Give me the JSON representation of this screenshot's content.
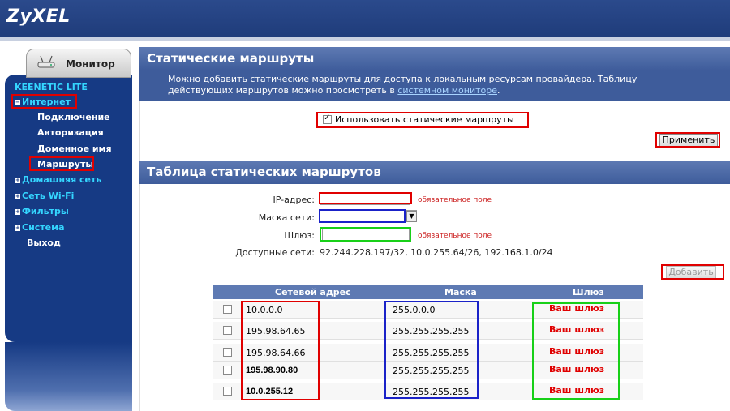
{
  "brand": {
    "logo": "ZyXEL"
  },
  "sidebar": {
    "monitor_tab": "Монитор",
    "model": "KEENETIC LITE",
    "items": [
      {
        "label": "Интернет"
      },
      {
        "label": "Подключение"
      },
      {
        "label": "Авторизация"
      },
      {
        "label": "Доменное имя"
      },
      {
        "label": "Маршруты"
      },
      {
        "label": "Домашняя сеть"
      },
      {
        "label": "Сеть Wi-Fi"
      },
      {
        "label": "Фильтры"
      },
      {
        "label": "Система"
      },
      {
        "label": "Выход"
      }
    ]
  },
  "static_routes": {
    "title": "Статические маршруты",
    "description_line1": "Можно добавить статические маршруты для доступа к локальным ресурсам провайдера. Таблицу",
    "description_line2_prefix": "действующих маршрутов можно просмотреть в",
    "description_link": "системном мониторе",
    "description_line2_suffix": ".",
    "use_static_label": "Использовать статические маршруты",
    "use_static_checked": true,
    "apply_button": "Применить"
  },
  "route_table": {
    "title": "Таблица статических маршрутов",
    "ip_label": "IP-адрес:",
    "mask_label": "Маска сети:",
    "gateway_label": "Шлюз:",
    "required_hint": "обязательное поле",
    "available_label": "Доступные сети:",
    "available_value": "92.244.228.197/32, 10.0.255.64/26, 192.168.1.0/24",
    "add_button": "Добавить",
    "columns": {
      "network": "Сетевой адрес",
      "mask": "Маска",
      "gateway": "Шлюз"
    },
    "rows": [
      {
        "network": "10.0.0.0",
        "mask": "255.0.0.0",
        "gateway": "Ваш шлюз"
      },
      {
        "network": "195.98.64.65",
        "mask": "255.255.255.255",
        "gateway": "Ваш шлюз"
      },
      {
        "network": "195.98.64.66",
        "mask": "255.255.255.255",
        "gateway": "Ваш шлюз"
      },
      {
        "network": "195.98.90.80",
        "mask": "255.255.255.255",
        "gateway": "Ваш шлюз"
      },
      {
        "network": "10.0.255.12",
        "mask": "255.255.255.255",
        "gateway": "Ваш шлюз"
      }
    ]
  },
  "colors": {
    "header": "#3e5c9b",
    "sidebar": "#163a84",
    "accent_cyan": "#34d6ff",
    "highlight_red": "#e00000",
    "highlight_blue": "#1a22c8",
    "highlight_green": "#18d018"
  }
}
